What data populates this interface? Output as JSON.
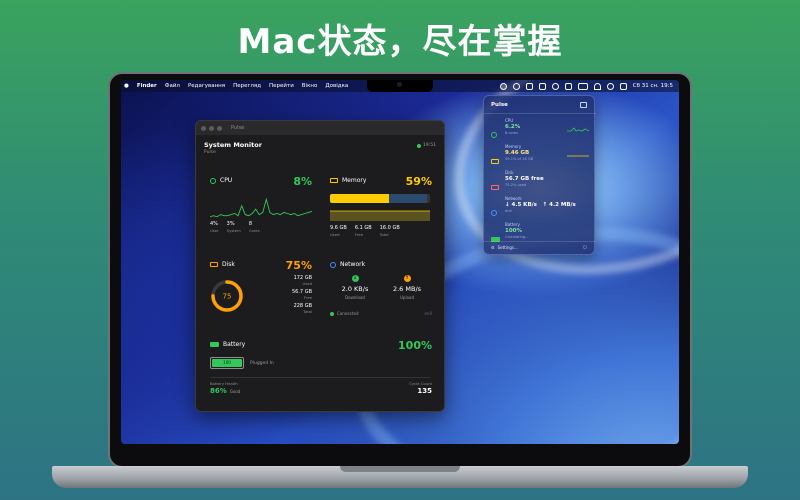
{
  "headline": "Mac状态，尽在掌握",
  "menubar": {
    "items": [
      "Finder",
      "Файл",
      "Редагування",
      "Перегляд",
      "Перейти",
      "Вікно",
      "Довідка"
    ],
    "datetime": "Сб 31 сн.  19:5"
  },
  "window": {
    "titlebar": "Pulse",
    "title": "System Monitor",
    "subtitle": "Pulse",
    "time": "19:51",
    "cpu": {
      "label": "CPU",
      "percent": "8%",
      "color": "#34c759",
      "stats": [
        {
          "value": "4%",
          "label": "User"
        },
        {
          "value": "3%",
          "label": "System"
        },
        {
          "value": "8",
          "label": "Cores"
        }
      ],
      "chart_data": {
        "type": "line",
        "values": [
          2,
          3,
          2,
          4,
          3,
          3,
          4,
          5,
          3,
          12,
          4,
          3,
          5,
          9,
          4,
          6,
          18,
          6,
          4,
          5,
          4,
          6,
          5,
          4,
          5,
          3,
          4,
          5,
          6,
          7
        ]
      }
    },
    "memory": {
      "label": "Memory",
      "percent": "59%",
      "color": "#ffcc00",
      "used_fraction": 0.59,
      "free_fraction": 0.38,
      "stats": [
        {
          "value": "9.6 GB",
          "label": "Used"
        },
        {
          "value": "6.1 GB",
          "label": "Free"
        },
        {
          "value": "16.0 GB",
          "label": "Total"
        }
      ]
    },
    "disk": {
      "label": "Disk",
      "percent": "75%",
      "gauge_value": "75",
      "fraction": 0.75,
      "color": "#ff9f0a",
      "stats": [
        {
          "value": "172 GB",
          "label": "Used"
        },
        {
          "value": "56.7 GB",
          "label": "Free"
        },
        {
          "value": "228 GB",
          "label": "Total"
        }
      ]
    },
    "network": {
      "label": "Network",
      "download": {
        "value": "2.0 KB/s",
        "label": "Download",
        "color": "#34c759"
      },
      "upload": {
        "value": "2.6 MB/s",
        "label": "Upload",
        "color": "#ff9f0a"
      },
      "status": "Connected",
      "interface": "en0"
    },
    "battery": {
      "label": "Battery",
      "percent": "100%",
      "color": "#34c759",
      "level": "100",
      "status": "Plugged In",
      "health_label": "Battery Health",
      "health": "86%",
      "health_status": "Good",
      "cycle_label": "Cycle Count",
      "cycles": "135"
    }
  },
  "dropdown": {
    "title": "Pulse",
    "rows": [
      {
        "label": "CPU",
        "value": "6.2%",
        "sub": "8 cores",
        "color": "#34c759"
      },
      {
        "label": "Memory",
        "value": "9.46 GB",
        "sub": "59.1% of 16 GB",
        "color": "#ffcc00"
      },
      {
        "label": "Disk",
        "value": "56.7 GB free",
        "sub": "75.2% used",
        "color": "#ff6b6b"
      },
      {
        "label": "Network",
        "value": "↓ 4.5 KB/s   ↑ 4.2 MB/s",
        "sub": "en0",
        "color": "#4a90ff"
      },
      {
        "label": "Battery",
        "value": "100%",
        "sub": "Calculating...",
        "color": "#34c759"
      }
    ],
    "footer": "Settings..."
  }
}
